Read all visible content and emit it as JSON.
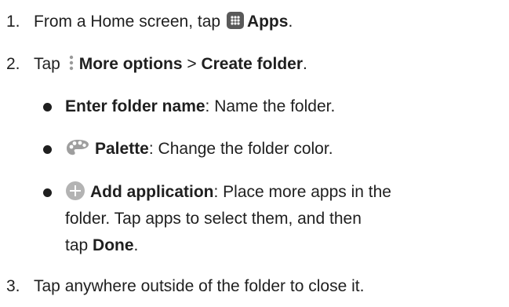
{
  "steps": [
    {
      "number": "1.",
      "pre": "From a Home screen, tap",
      "icon": "apps-grid-icon",
      "bold": "Apps",
      "post": "."
    },
    {
      "number": "2.",
      "pre": "Tap",
      "icon": "more-options-icon",
      "bold1": "More options",
      "sep": " > ",
      "bold2": "Create folder",
      "post": "."
    },
    {
      "number": "3.",
      "text": "Tap anywhere outside of the folder to close it."
    }
  ],
  "bullets": [
    {
      "bold": "Enter folder name",
      "text": ": Name the folder."
    },
    {
      "icon": "palette-icon",
      "bold": "Palette",
      "text": ": Change the folder color."
    },
    {
      "icon": "add-circle-icon",
      "bold": "Add application",
      "line1": ": Place more apps in the",
      "line2": "folder. Tap apps to select them, and then",
      "line3_pre": "tap ",
      "line3_bold": "Done",
      "line3_post": "."
    }
  ],
  "colors": {
    "text": "#1f1f1f",
    "apps_icon_bg": "#5a5a5a",
    "palette_icon": "#9e9e9e",
    "add_icon": "#b3b3b3"
  }
}
